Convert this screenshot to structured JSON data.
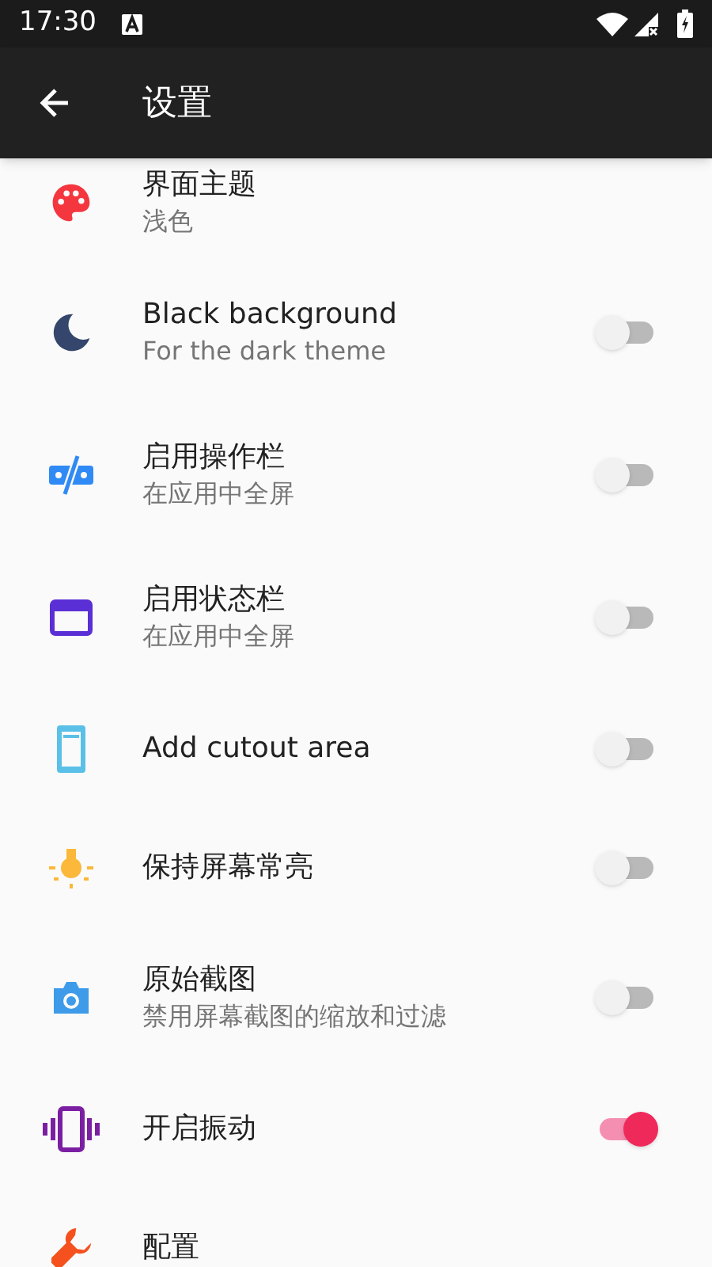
{
  "status_bar": {
    "time": "17:30"
  },
  "app_bar": {
    "title": "设置"
  },
  "items": [
    {
      "kind": "plain",
      "title": "界面主题",
      "subtitle": "浅色"
    },
    {
      "kind": "toggle",
      "title": "Black background",
      "subtitle": "For the dark theme",
      "on": false
    },
    {
      "kind": "toggle",
      "title": "启用操作栏",
      "subtitle": "在应用中全屏",
      "on": false
    },
    {
      "kind": "toggle",
      "title": "启用状态栏",
      "subtitle": "在应用中全屏",
      "on": false
    },
    {
      "kind": "toggle",
      "title": "Add cutout area",
      "on": false
    },
    {
      "kind": "toggle",
      "title": "保持屏幕常亮",
      "on": false
    },
    {
      "kind": "toggle",
      "title": "原始截图",
      "subtitle": "禁用屏幕截图的缩放和过滤",
      "on": false
    },
    {
      "kind": "toggle",
      "title": "开启振动",
      "on": true
    },
    {
      "kind": "plain",
      "title": "配置"
    }
  ]
}
